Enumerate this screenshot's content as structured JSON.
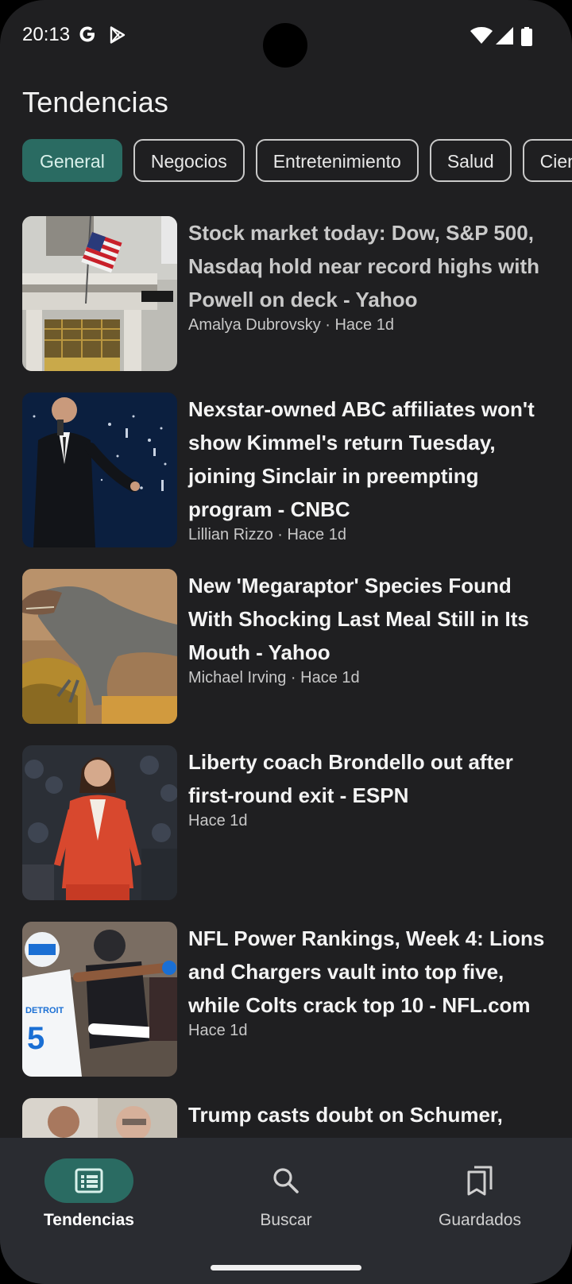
{
  "status_bar": {
    "time": "20:13",
    "icons": [
      "google-icon",
      "play-store-icon",
      "wifi-icon",
      "signal-icon",
      "battery-icon"
    ]
  },
  "header": {
    "title": "Tendencias"
  },
  "categories": {
    "selected": "General",
    "items": [
      "General",
      "Negocios",
      "Entretenimiento",
      "Salud",
      "Ciencia"
    ]
  },
  "news": [
    {
      "headline": "Stock market today: Dow, S&P 500, Nasdaq hold near record highs with Powell on deck - Yahoo",
      "meta": "Amalya Dubrovsky · Hace 1d",
      "image": "new-york-stock-exchange"
    },
    {
      "headline": "Nexstar-owned ABC affiliates won't show Kimmel's return Tuesday, joining Sinclair in preempting program - CNBC",
      "meta": "Lillian Rizzo · Hace 1d",
      "image": "man-on-stage-microphone"
    },
    {
      "headline": "New 'Megaraptor' Species Found With Shocking Last Meal Still in Its Mouth - Yahoo",
      "meta": "Michael Irving · Hace 1d",
      "image": "dinosaur-illustration"
    },
    {
      "headline": "Liberty coach Brondello out after first-round exit - ESPN",
      "meta": "Hace 1d",
      "image": "coach-red-blazer"
    },
    {
      "headline": "NFL Power Rankings, Week 4: Lions and Chargers vault into top five, while Colts crack top 10 - NFL.com",
      "meta": "Hace 1d",
      "image": "football-players"
    },
    {
      "headline": "Trump casts doubt on Schumer,",
      "meta": "",
      "image": "two-men-portrait"
    }
  ],
  "bottom_nav": {
    "active": "Tendencias",
    "items": [
      {
        "label": "Tendencias",
        "icon": "news-list-icon"
      },
      {
        "label": "Buscar",
        "icon": "search-icon"
      },
      {
        "label": "Guardados",
        "icon": "bookmarks-icon"
      }
    ]
  },
  "colors": {
    "background": "#1f1f21",
    "accent": "#2a6b62",
    "nav_background": "#2a2c31",
    "text_primary": "#f4f4f4",
    "text_secondary": "#c8c8c8"
  }
}
